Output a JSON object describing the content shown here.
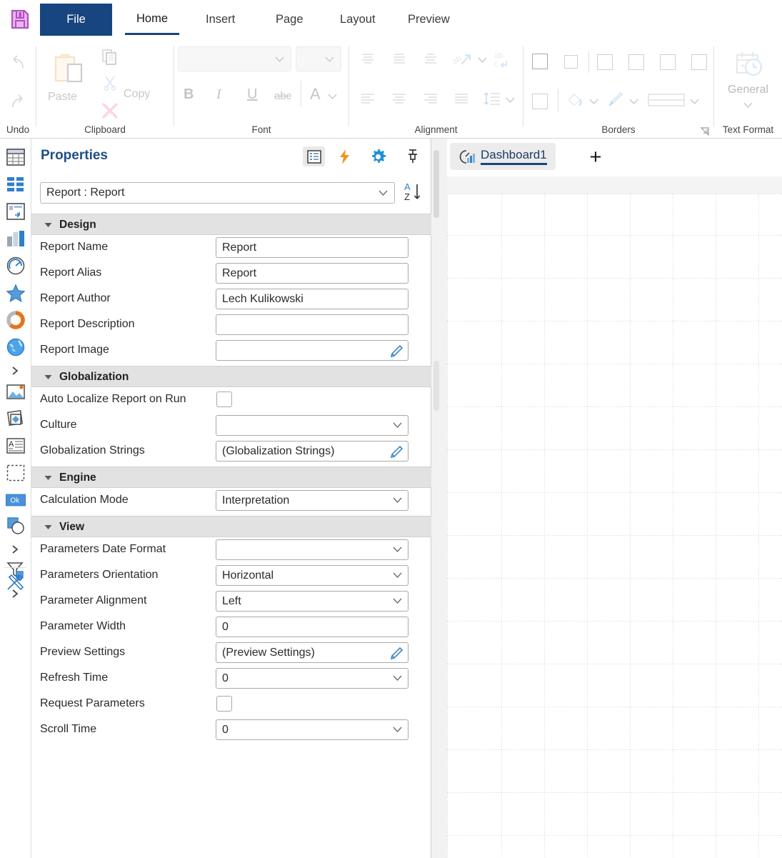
{
  "ribbon": {
    "save_icon": "save-floppy-icon",
    "tabs": [
      {
        "label": "File",
        "state": "file"
      },
      {
        "label": "Home",
        "state": "active"
      },
      {
        "label": "Insert",
        "state": "normal"
      },
      {
        "label": "Page",
        "state": "normal"
      },
      {
        "label": "Layout",
        "state": "normal"
      },
      {
        "label": "Preview",
        "state": "normal"
      }
    ],
    "groups": {
      "undo": {
        "label": "Undo",
        "undo_icon": "undo-arrow-icon",
        "redo_icon": "redo-arrow-icon"
      },
      "clipboard": {
        "label": "Clipboard",
        "paste": "Paste",
        "copy": "Copy",
        "cut": "Cut",
        "delete": "Delete"
      },
      "font": {
        "label": "Font",
        "font_family_value": "",
        "font_size_value": "",
        "bold": "B",
        "italic": "I",
        "underline": "U",
        "strike": "abc",
        "font_color": "A"
      },
      "alignment": {
        "label": "Alignment"
      },
      "borders": {
        "label": "Borders"
      },
      "text_format": {
        "label": "Text Format",
        "value": "General"
      }
    }
  },
  "left_toolbar": {
    "items": [
      {
        "name": "table-tool",
        "icon": "table-icon"
      },
      {
        "name": "cards-tool",
        "icon": "cards-grid-icon"
      },
      {
        "name": "pivot-tool",
        "icon": "pivot-table-icon"
      },
      {
        "name": "chart-tool",
        "icon": "bar-chart-icon"
      },
      {
        "name": "gauge-tool",
        "icon": "gauge-icon"
      },
      {
        "name": "indicator-tool",
        "icon": "star-icon"
      },
      {
        "name": "progress-tool",
        "icon": "donut-progress-icon"
      },
      {
        "name": "map-tool",
        "icon": "globe-icon"
      },
      {
        "name": "more-visuals",
        "icon": "chevron-right-icon"
      },
      {
        "name": "image-tool",
        "icon": "image-icon"
      },
      {
        "name": "shape-tool",
        "icon": "shape-icon"
      },
      {
        "name": "text-tool",
        "icon": "text-block-icon"
      },
      {
        "name": "panel-tool",
        "icon": "dashed-panel-icon"
      },
      {
        "name": "button-tool",
        "icon": "ok-button-icon"
      },
      {
        "name": "combo-shape-tool",
        "icon": "square-circle-icon"
      },
      {
        "name": "more-shapes",
        "icon": "chevron-right-icon"
      },
      {
        "name": "filter-tool",
        "icon": "funnel-icon"
      },
      {
        "name": "more-filters",
        "icon": "chevron-right-icon"
      },
      {
        "name": "tools-tool",
        "icon": "hammer-wrench-icon"
      }
    ]
  },
  "properties": {
    "title": "Properties",
    "header_buttons": [
      {
        "name": "list-view-button",
        "icon": "list-icon",
        "selected": true
      },
      {
        "name": "events-button",
        "icon": "lightning-bolt-icon",
        "selected": false
      },
      {
        "name": "settings-button",
        "icon": "gear-icon",
        "selected": false
      },
      {
        "name": "pin-button",
        "icon": "pin-icon",
        "selected": false
      }
    ],
    "selector_value": "Report : Report",
    "sort_button": "sort-az-button",
    "sections": [
      {
        "name": "Design",
        "rows": [
          {
            "label": "Report Name",
            "type": "text",
            "value": "Report"
          },
          {
            "label": "Report Alias",
            "type": "text",
            "value": "Report"
          },
          {
            "label": "Report Author",
            "type": "text",
            "value": "Lech Kulikowski"
          },
          {
            "label": "Report Description",
            "type": "text",
            "value": ""
          },
          {
            "label": "Report Image",
            "type": "editor",
            "value": ""
          }
        ]
      },
      {
        "name": "Globalization",
        "rows": [
          {
            "label": "Auto Localize Report on Run",
            "type": "checkbox",
            "value": false
          },
          {
            "label": "Culture",
            "type": "select",
            "value": ""
          },
          {
            "label": "Globalization Strings",
            "type": "editor",
            "value": "(Globalization Strings)"
          }
        ]
      },
      {
        "name": "Engine",
        "rows": [
          {
            "label": "Calculation Mode",
            "type": "select",
            "value": "Interpretation"
          }
        ]
      },
      {
        "name": "View",
        "rows": [
          {
            "label": "Parameters Date Format",
            "type": "select",
            "value": ""
          },
          {
            "label": "Parameters Orientation",
            "type": "select",
            "value": "Horizontal"
          },
          {
            "label": "Parameter Alignment",
            "type": "select",
            "value": "Left"
          },
          {
            "label": "Parameter Width",
            "type": "text",
            "value": "0"
          },
          {
            "label": "Preview Settings",
            "type": "editor",
            "value": "(Preview Settings)"
          },
          {
            "label": "Refresh Time",
            "type": "select",
            "value": "0"
          },
          {
            "label": "Request Parameters",
            "type": "checkbox",
            "value": false
          },
          {
            "label": "Scroll Time",
            "type": "select",
            "value": "0"
          }
        ]
      }
    ]
  },
  "workspace": {
    "tabs": [
      {
        "label": "Dashboard1",
        "icon": "dashboard-gauge-chart-icon",
        "active": true
      }
    ],
    "add_tab_label": "+"
  },
  "colors": {
    "accent_blue": "#17457f",
    "title_blue": "#1f4e87",
    "gear_blue": "#1f8fd6",
    "bolt_orange": "#f2941b",
    "save_purple": "#c56fd0",
    "canvas_bg": "#f4f4f4"
  }
}
